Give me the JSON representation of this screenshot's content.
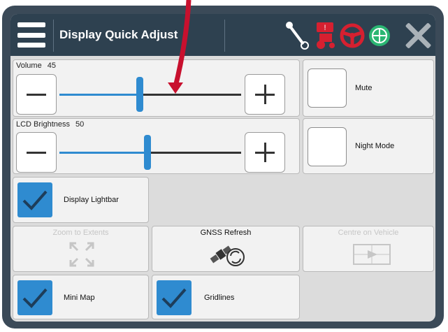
{
  "titlebar": {
    "title": "Display Quick Adjust",
    "icons": [
      "menu-icon",
      "implement-steering-icon",
      "tractor-alert-icon",
      "steering-wheel-icon",
      "gnss-globe-icon",
      "close-icon"
    ],
    "background": "#2e4150"
  },
  "volume": {
    "label": "Volume",
    "value": "45",
    "level": 0.45
  },
  "brightness": {
    "label": "LCD Brightness",
    "value": "50",
    "level": 0.5
  },
  "mute": {
    "label": "Mute",
    "checked": false
  },
  "night_mode": {
    "label": "Night Mode",
    "checked": false
  },
  "lightbar": {
    "label": "Display Lightbar",
    "checked": true
  },
  "zoom_extents": {
    "label": "Zoom to Extents",
    "enabled": false
  },
  "gnss_refresh": {
    "label": "GNSS Refresh",
    "enabled": true
  },
  "centre_vehicle": {
    "label": "Centre on Vehicle",
    "enabled": false
  },
  "mini_map": {
    "label": "Mini Map",
    "checked": true
  },
  "gridlines": {
    "label": "Gridlines",
    "checked": true
  },
  "colors": {
    "accent": "#2f8bd0",
    "alert": "#d62030",
    "gnss": "#2bb673"
  }
}
